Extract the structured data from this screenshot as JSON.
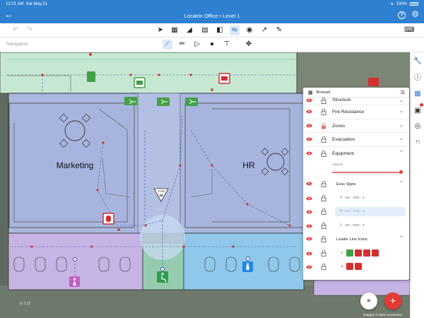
{
  "status": {
    "time": "12:01 AM",
    "date": "Sat May 21",
    "battery": "100%"
  },
  "app": {
    "title": "Locatrix Office • Level 1"
  },
  "subbar": {
    "nav_label": "Navigation"
  },
  "map": {
    "rooms": [
      "Marketing",
      "HR"
    ],
    "zone_sign": {
      "top": "ZONE",
      "bottom": "09"
    },
    "version": "v5.0.25",
    "imagery": "Imagery © 2022 Aerometrex"
  },
  "browser": {
    "title": "Browser",
    "layers": [
      "Structure",
      "Fire Resistance",
      "Zones",
      "Evacuation",
      "Equipment"
    ],
    "opacity_label": "Opacity",
    "evac_signs": {
      "label": "Evac Signs",
      "items": [
        "AG - YAH - 1",
        "AG - YAH - 2",
        "AG - YAH - 3"
      ],
      "selected": 1
    },
    "leader_line_icons": {
      "label": "Leader Line Icons"
    }
  },
  "colors": {
    "accent": "#2f80d1",
    "red": "#e53935",
    "green": "#43a047",
    "office_blue": "#aab8df",
    "corridor_green": "#c6e8d3",
    "amenity_purple": "#c6b4e4",
    "amenity_cyan": "#8fc8ea"
  }
}
